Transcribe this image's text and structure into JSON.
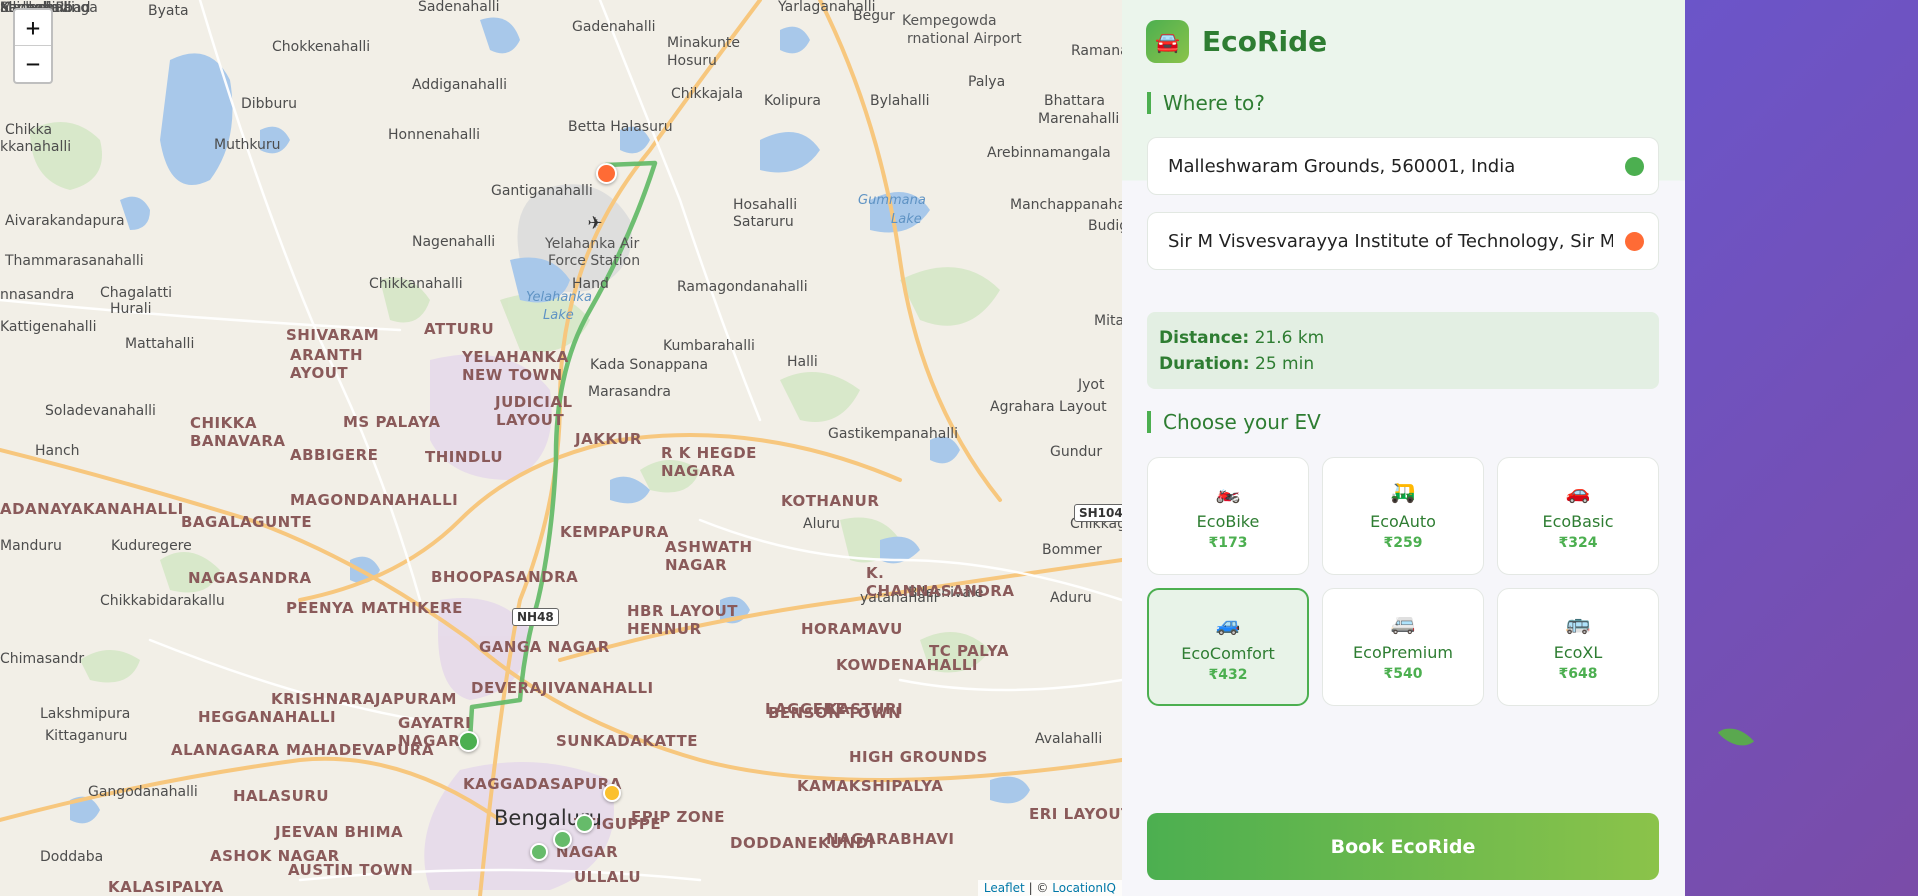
{
  "map": {
    "zoom_in": "+",
    "zoom_out": "−",
    "attribution": {
      "leaflet": "Leaflet",
      "separator": " | © ",
      "provider": "LocationIQ"
    },
    "route_badges": [
      "NH48",
      "SH104"
    ],
    "labels": {
      "towns": [
        "Byata",
        "Sadenahalli",
        "Yarlaganahalli",
        "Chokkenahalli",
        "Gadenahalli",
        "Minakunte",
        "Hosuru",
        "Begur",
        "Ramana",
        "Addiganahalli",
        "Palya",
        "Chikkajala",
        "Kolipura",
        "Bylahalli",
        "Bhattara",
        "Marenahalli",
        "Dibburu",
        "Chikka",
        "kkanahalli",
        "Muthkuru",
        "Honnenahalli",
        "Betta Halasuru",
        "Arebinnamangala",
        "Gantiganahalli",
        "Hosahalli",
        "Manchappanahalli",
        "Aivarakandapura",
        "Nagenahalli",
        "Sataruru",
        "Budig",
        "Thammarasanahalli",
        "Chagalatti",
        "Hand",
        "nnasandra",
        "Hurali",
        "Chikkanahalli",
        "Ramagondanahalli",
        "Kattigenahalli",
        "Mattahalli",
        "Kumbarahalli",
        "Mitaganahalli",
        "Kada Sonappana",
        "Halli",
        "Marasandra",
        "Jyot",
        "Agrahara Layout",
        "Soladevanahalli",
        "Gastikempanahalli",
        "Hanch",
        "Gundur",
        "Aluru",
        "Chikkagubbi",
        "Manduru",
        "Kuduregere",
        "Bommer",
        "Bileshivale",
        "Aduru",
        "yatanahalli",
        "Chikkabidarakallu",
        "Chimasandr",
        "Lakshmipura",
        "Kittaganuru",
        "Avalahalli",
        "Gangodanahalli",
        "Doddaba",
        "alli",
        "Machohalli",
        "Kachohalli",
        "Sadaramanga",
        "Magadi Road",
        "Kannalli"
      ],
      "areas": [
        "SHIVARAM",
        "ARANTH",
        "AYOUT",
        "ATTURU",
        "YELAHANKA",
        "NEW TOWN",
        "JUDICIAL",
        "LAYOUT",
        "CHIKKA",
        "BANAVARA",
        "MS PALAYA",
        "JAKKUR",
        "R K HEGDE",
        "NAGARA",
        "ABBIGERE",
        "THINDLU",
        "MAGONDANAHALLI",
        "KOTHANUR",
        "ADANAYAKANAHALLI",
        "BAGALAGUNTE",
        "KEMPAPURA",
        "ASHWATH",
        "NAGAR",
        "NAGASANDRA",
        "BHOOPASANDRA",
        "K.",
        "CHANNASANDRA",
        "PEENYA",
        "MATHIKERE",
        "HBR LAYOUT",
        "HENNUR",
        "HORAMAVU",
        "TC PALYA",
        "GANGA NAGAR",
        "KOWDENAHALLI",
        "DEVERAJIVANAHALLI",
        "LAGGERE",
        "KASTURI",
        "KRISHNARAJAPURAM",
        "HEGGANAHALLI",
        "GAYATRI",
        "NAGAR",
        "BENSON TOWN",
        "SUNKADAKATTE",
        "ALANAGARA",
        "MAHADEVAPURA",
        "HIGH GROUNDS",
        "KAGGADASAPURA",
        "KAMAKSHIPALYA",
        "HALASURU",
        "EPIP ZONE",
        "ERI LAYOUT",
        "JEEVAN BHIMA",
        "DODDANEKUNDI",
        "NAGARABHAVI",
        "ASHOK NAGAR",
        "NAGAR",
        "TTIGUPPE",
        "AUSTIN TOWN",
        "ULLALU",
        "KALASIPALYA"
      ],
      "water": [
        "Gummana",
        "Lake",
        "Yelahanka",
        "Lake"
      ],
      "city": "Bengaluru",
      "airport": [
        "Yelahanka Air",
        "Force Station",
        "Kempegowda",
        "rnational Airport"
      ]
    }
  },
  "panel": {
    "brand": {
      "icon": "🚘",
      "title": "EcoRide"
    },
    "where_to_title": "Where to?",
    "pickup": {
      "value": "Malleshwaram Grounds, 560001, India",
      "dot_color": "#4caf50"
    },
    "dropoff": {
      "value": "Sir M Visvesvarayya Institute of Technology, Sir MVI",
      "dot_color": "#ff6b35"
    },
    "trip": {
      "distance_label": "Distance:",
      "distance_value": "21.6 km",
      "duration_label": "Duration:",
      "duration_value": "25 min"
    },
    "choose_title": "Choose your EV",
    "vehicles": [
      {
        "icon": "🏍️",
        "name": "EcoBike",
        "price": "₹173",
        "selected": false
      },
      {
        "icon": "🛺",
        "name": "EcoAuto",
        "price": "₹259",
        "selected": false
      },
      {
        "icon": "🚗",
        "name": "EcoBasic",
        "price": "₹324",
        "selected": false
      },
      {
        "icon": "🚙",
        "name": "EcoComfort",
        "price": "₹432",
        "selected": true
      },
      {
        "icon": "🚐",
        "name": "EcoPremium",
        "price": "₹540",
        "selected": false
      },
      {
        "icon": "🚌",
        "name": "EcoXL",
        "price": "₹648",
        "selected": false
      }
    ],
    "book_button": "Book EcoRide"
  },
  "colors": {
    "accent": "#4caf50",
    "accent_dark": "#2e7d32",
    "dropoff": "#ff6b35",
    "route": "#66bb6a",
    "sidebar_gradient": "#6b55c9"
  }
}
